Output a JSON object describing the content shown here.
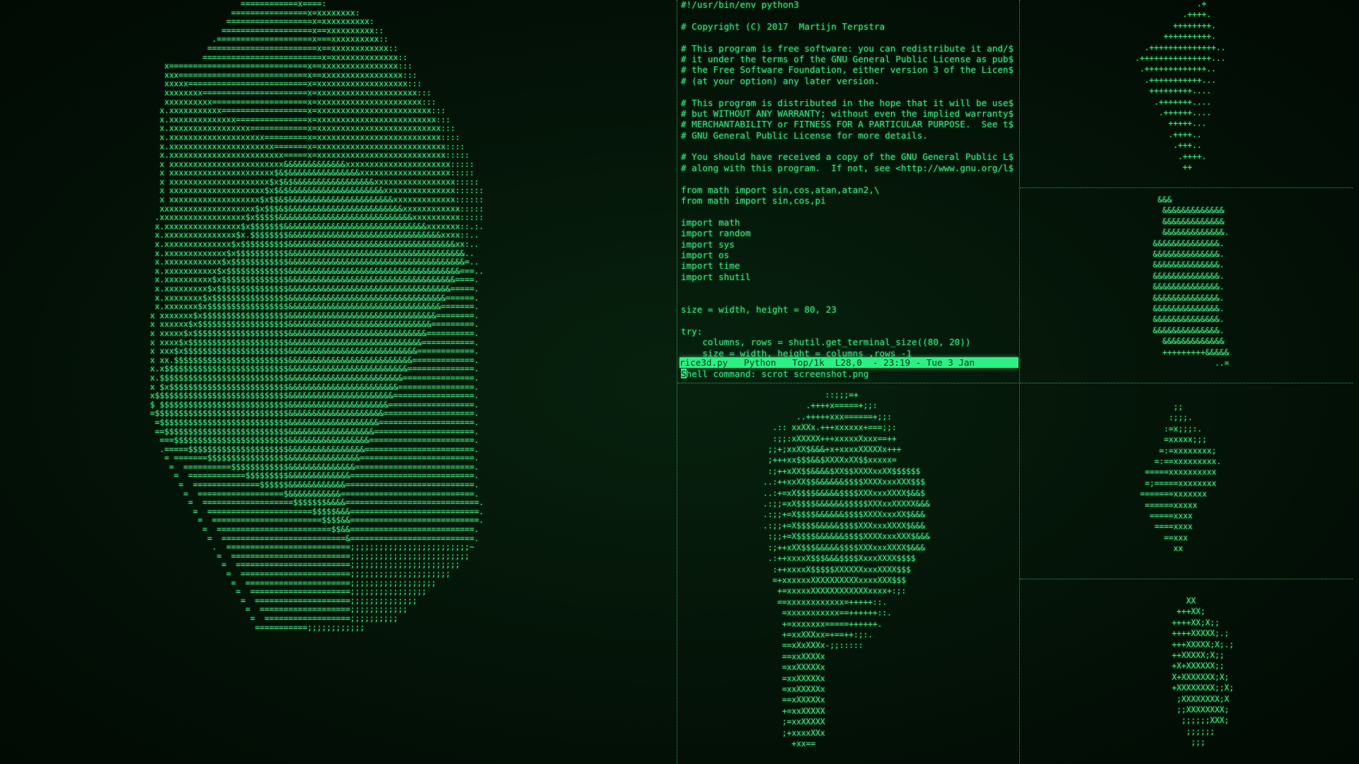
{
  "screen": {
    "theme_color": "#3ce07d",
    "background": "#041106"
  },
  "panes": {
    "big_object": {
      "art": "                   ============x====:\n                 ================x=xxxxxxxx:\n                ==================x=xxxxxxxxxx:\n               ===================x==xxxxxxxxxx::\n             .====================x===xxxxxxxxxx::\n            =======================x==xxxxxxxxxxxx::\n           =========================x=xxxxxxxxxxxxxx::\n   x=============================x==xxxxxxxxxxxxxxxx:::\n   xxx===========================x==xxxxxxxxxxxxxxxxx:::\n   xxxxx=========================x=xxxxxxxxxxxxxxxxxxx:::\n   xxxxxxxx======================x=xxxxxxxxxxxxxxxxxxxxx:::\n   xxxxxxxxxx====================x=xxxxxxxxxxxxxxxxxxxxxx:::\n  x.xxxxxxxxxxx==================x=xxxxxxxxxxxxxxxxxxxxxxxx:::\n  x.xxxxxxxxxxxxxx===============x=xxxxxxxxxxxxxxxxxxxxxxxxx:::\n  x.xxxxxxxxxxxxxxxxx============x=xxxxxxxxxxxxxxxxxxxxxxxxxx:::\n  x.xxxxxxxxxxxxxxxxxxxx=========x=xxxxxxxxxxxxxxxxxxxxxxxxxx::::\n  x.xxxxxxxxxxxxxxxxxxxxxx=======x=xxxxxxxxxxxxxxxxxxxxxxxxxxx::::\n  x.xxxxxxxxxxxxxxxxxxxxxxxx=====x=xxxxxxxxxxxxxxxxxxxxxxxxxxx:::::\n  x xxxxxxxxxxxxxxxxxxxxxxxx&&&&&&&&&&&&&xxxxxxxxxxxxxxxxxxxxxx:::::\n  x xxxxxxxxxxxxxxxxxxxxxx$&$&&&&&&&&&&&&&&&xxxxxxxxxxxxxxxxxxx:::::\n  x xxxxxxxxxxxxxxxxxxxxx$x$&$&&&&&&&&&&&&&&&&&xxxxxxxxxxxxxxxxx:::::\n  x xxxxxxxxxxxxxxxxxxxx$x$&$&&&&&&&&&&&&&&&&&&&&xxxxxxxxxxxxxxx::::::\n  x xxxxxxxxxxxxxxxxxxx$x$$&$&&&&&&&&&&&&&&&&&&&&&&xxxxxxxxxxxxx::::::\n  xxxxxxxxxxxxxxxxxxxx$x$$$&$&&&&&&&&&&&&&&&&&&&&&&&&xxxxxxxxxxxx:::::\n .xxxxxxxxxxxxxxxxxx$x$$$$$&&&&&&&&&&&&&&&&&&&&&&&&&&&&xxxxxxxxxx:::::\n x.xxxxxxxxxxxxxxxx$x$$$$$$$&&&&&&&&&&&&&&&&&&&&&&&&&&&&&&xxxxxxx::.:.\n x.xxxxxxxxxxxxxxx$x.$$$$$$$$&&&&&&&&&&&&&&&&&&&&&&&&&&&&&&&&xxxx::..\n x.xxxxxxxxxxxxxx$x$$$$$$$$$$&&&&&&&&&&&&&&&&&&&&&&&&&&&&&&&&&&&xx:..\n x.xxxxxxxxxxxxx$x$$$$$$$$$$$&&&&&&&&&&&&&&&&&&&&&&&&&&&&&&&&&&&&&..\n x.xxxxxxxxxxxx$x$$$$$$$$$$$$&&&&&&&&&&&&&&&&&&&&&&&&&&&&&&&&&&&&&=..\n x.xxxxxxxxxxx$x$$$$$$$$$$$$$&&&&&&&&&&&&&&&&&&&&&&&&&&&&&&&&&&&&===..\n x.xxxxxxxxxx$x$$$$$$$$$$$$$$&&&&&&&&&&&&&&&&&&&&&&&&&&&&&&&&&&&====.\n x.xxxxxxxxx$x$$$$$$$$$$$$$$$&&&&&&&&&&&&&&&&&&&&&&&&&&&&&&&&&&=====.\n x.xxxxxxxx$x$$$$$$$$$$$$$$$$&&&&&&&&&&&&&&&&&&&&&&&&&&&&&&&&&======.\n x.xxxxxxx$x$$$$$$$$$$$$$$$$$&&&&&&&&&&&&&&&&&&&&&&&&&&&&&&&&=======.\nx xxxxxxx$x$$$$$$$$$$$$$$$$$$&&&&&&&&&&&&&&&&&&&&&&&&&&&&&&&========.\nx xxxxxx$x$$$$$$$$$$$$$$$$$$$&&&&&&&&&&&&&&&&&&&&&&&&&&&&&&=========.\nx xxxxx$x$$$$$$$$$$$$$$$$$$$$&&&&&&&&&&&&&&&&&&&&&&&&&&&&&==========.\nx xxxx$x$$$$$$$$$$$$$$$$$$$$$&&&&&&&&&&&&&&&&&&&&&&&&&&&&===========.\nx xxx$x$$$$$$$$$$$$$$$$$$$$$$&&&&&&&&&&&&&&&&&&&&&&&&&&&============.\nx xx.$$$$$$$$$$$$$$$$$$$$$$$$&&&&&&&&&&&&&&&&&&&&&&&&&&=============.\nx.x$$$$$$$$$$$$$$$$$$$$$$$$$$&&&&&&&&&&&&&&&&&&&&&&&&&==============.\nx.$$$$$$$$$$$$$$$$$$$$$$$$$$$&&&&&&&&&&&&&&&&&&&&&&&&===============.\nx $x$$$$$$$$$$$$$$$$$$$$$$$$$&&&&&&&&&&&&&&&&&&&&&&&================.\nx$$$$$$$$$$$$$$$$$$$$$$$$$$$$&&&&&&&&&&&&&&&&&&&&&&=================.\n$ $$$$$$$$$$$$$$$$$$$$$$$$$$$&&&&&&&&&&&&&&&&&&&&&==================.\n=$$$$$$$$$$$$$$$$$$$$$$$$$$$$&&&&&&&&&&&&&&&&&&&&===================.\n =$$$$$$$$$$$$$$$$$$$$$$$$$$$&&&&&&&&&&&&&&&&&&&====================.\n ==$$$$$$$$$$$$$$$$$$$$$$$$$$&&&&&&&&&&&&&&&&&&=====================.\n  ===$$$$$$$$$$$$$$$$$$$$$$$$&&&&&&&&&&&&&&&&&======================.\n  .=====$$$$$$$$$$$$$$$$$$$$$&&&&&&&&&&&&&&&&=======================.\n   = =======$$$$$$$$$$$$$$$$$&&&&&&&&&&&&&&&========================.\n    =  ==========$$$$$$$$$$$$&&&&&&&&&&&&&&=========================.\n     =  ============$$$$$$$$$&&&&&&&&&&&&&==========================.\n      =  ==============$$$$$$&&&&&&&&&&&&===========================.\n       =  ==================$&&&&&&&&&&&============================.\n        =  ===================$$$$$$$&&&&============================.\n         =  ======================$$$$$&&&===========================.\n          =  =======================$$$$&&===========================.\n           =  ========================$$&&==========================.\n            =  ==========================&==========================.\n             .  ==========================;;;;;;;;;;;;;;;;;;;;;;;;;~\n              =  =========================;;;;;;;;;;;;;;;;;;;;;;;;;\n               =  ========================;;;;;;;;;;;;;;;;;;;;;;;\n                =  =======================;;;;;;;;;;;;;;;;;;;;;\n                 =  ======================;;;;;;;;;;;;;;;;;;\n                  =  =====================;;;;;;;;;;;;;;;;\n                   =  ====================;;;;;;;;;;;;;;\n                    =  ===================;;;;;;;;;;;;\n                     =  ==================;;;;;;;;;;\n                      ===========;;;;;;;;;;;;"
    },
    "editor": {
      "lines": [
        "#!/usr/bin/env python3",
        "",
        "# Copyright (C) 2017  Martijn Terpstra",
        "",
        "# This program is free software: you can redistribute it and/$",
        "# it under the terms of the GNU General Public License as pub$",
        "# the Free Software Foundation, either version 3 of the Licen$",
        "# (at your option) any later version.",
        "",
        "# This program is distributed in the hope that it will be use$",
        "# but WITHOUT ANY WARRANTY; without even the implied warranty$",
        "# MERCHANTABILITY or FITNESS FOR A PARTICULAR PURPOSE.  See t$",
        "# GNU General Public License for more details.",
        "",
        "# You should have received a copy of the GNU General Public L$",
        "# along with this program.  If not, see <http://www.gnu.org/l$",
        "",
        "from math import sin,cos,atan,atan2,\\",
        "from math import sin,cos,pi",
        "",
        "import math",
        "import random",
        "import sys",
        "import os",
        "import time",
        "import shutil",
        "",
        "",
        "size = width, height = 80, 23",
        "",
        "try:",
        "    columns, rows = shutil.get_terminal_size((80, 20))",
        "    size = width, height = columns ,rows -1"
      ],
      "status_line": "rice3d.py   Python   Top/1k  L28,0  - 23:19 - Tue 3 Jan",
      "minibuffer_prefix": "S",
      "minibuffer_text": "hell command: scrot screenshot.png"
    },
    "top_right": {
      "art": "               .+\n            .++++.\n          ++++++++.\n        ++++++++++.\n    .++++++++++++++..\n  .+++++++++++++++...\n   .+++++++++++++..\n    .+++++++++++...\n     +++++++++....\n      .+++++++....\n       .++++++....\n         +++++...\n         .++++..\n          .+++..\n           .++++.\n            ++"
    },
    "mid_right": {
      "art": "  &&&\n   &&&&&&&&&&&&&\n   &&&&&&&&&&&&&\n   &&&&&&&&&&&&&.\n &&&&&&&&&&&&&&.\n &&&&&&&&&&&&&&.\n &&&&&&&&&&&&&&.\n &&&&&&&&&&&&&&.\n &&&&&&&&&&&&&&.\n &&&&&&&&&&&&&&.\n &&&&&&&&&&&&&&.\n &&&&&&&&&&&&&&.\n &&&&&&&&&&&&&&.\n   &&&&&&&&&&&&&\n   +++++++++&&&&&\n              ..="
    },
    "lower_mid_right": {
      "art": "        ;;\n       :;;;.\n      :=x;;;:.\n      =xxxxx;;;\n     =:=xxxxxxxx;\n    =:==xxxxxxxxx.\n  =====xxxxxxxxxx\n  =;=====xxxxxxxx\n =======xxxxxxx\n  ======xxxxx\n   =====xxxx\n    ====xxxx\n      ==xxx\n        xx"
    },
    "bottom_right": {
      "art": "        XX\n      +++XX;\n     ++++XX;X;;\n     ++++XXXXX;.;\n     +++XXXXX;X;.;\n     ++XXXXX;X;;\n     +X+XXXXXX;;\n     X+XXXXXXX;X;\n     +XXXXXXXX;;X;\n      ;XXXXXXXX;X\n      ;;XXXXXXXX;\n       ;;;;;;XXX;\n        ;;;;;;\n         ;;;"
    },
    "bottom_mid": {
      "art": "             ::;;;=+\n         .++++x=====+;;:\n       ..+++++xxx======+;;:\n  .:: xxXXx.+++xxxxxx+===;;:\n  :;;:xXXXXX+++xxxxxXxxx==++\n ;;+;xxXX$&&&+x+xxxxXXXXXx+++\n ;+++xx$$$&&$XXXXxXX$$xxxxx=\n :;++xXX$$&&&&$XX$$XXXXxxXX$$$$$$\n..:++xxXX$$&&&&&&$$$$XXXXxxxXXX$$$\n..:+=xX$$$$&&&&&$$$$XXXxxxXXXX$&&$\n.:;;=xX$$$$&&&&&&$$$$$XXXxxXXXXX&&&\n.:;;+=X$$$$&&&&&&$$$$XXXXxxxXX$&&&\n.:;;+=X$$$$&&&&&$$$$XXXxxxXXXX$&&&\n :;;+=X$$$$&&&&&&$$$$XXXXxxxXXX$&&&\n :;++xXX$$$&&&&&$$$$XXXxxxXXXX$&&&\n .:++xxxxX$$$&&&$$$$XxxxXXXX$$$$\n  :++xxxxX$$$$$XXXXXXxxxXXXX$$$\n  =+xxxxxxXXXXXXXXXXxxxxXXX$$$\n   +=xxxxxXXXXXXXXXXXXxxxx+:;:\n   ==xxxxxxxxxxxx=+++++::.\n    =xxxxxxxxxxx==++++++::.\n    +=xxxxxxx=====++++++.\n    +=xxXXXxx=+==++:;:.\n    ==xXxXXXx-;;:::::\n    ==xxXXXXx\n    =xxXXXXXx\n    =xxXXXXXx\n    =xxXXXXXx\n    ==xXXXXXx\n    +=xxXXXXX\n    ;=xxXXXXX\n    ;+xxxxXXx\n      +xx=="
    }
  }
}
